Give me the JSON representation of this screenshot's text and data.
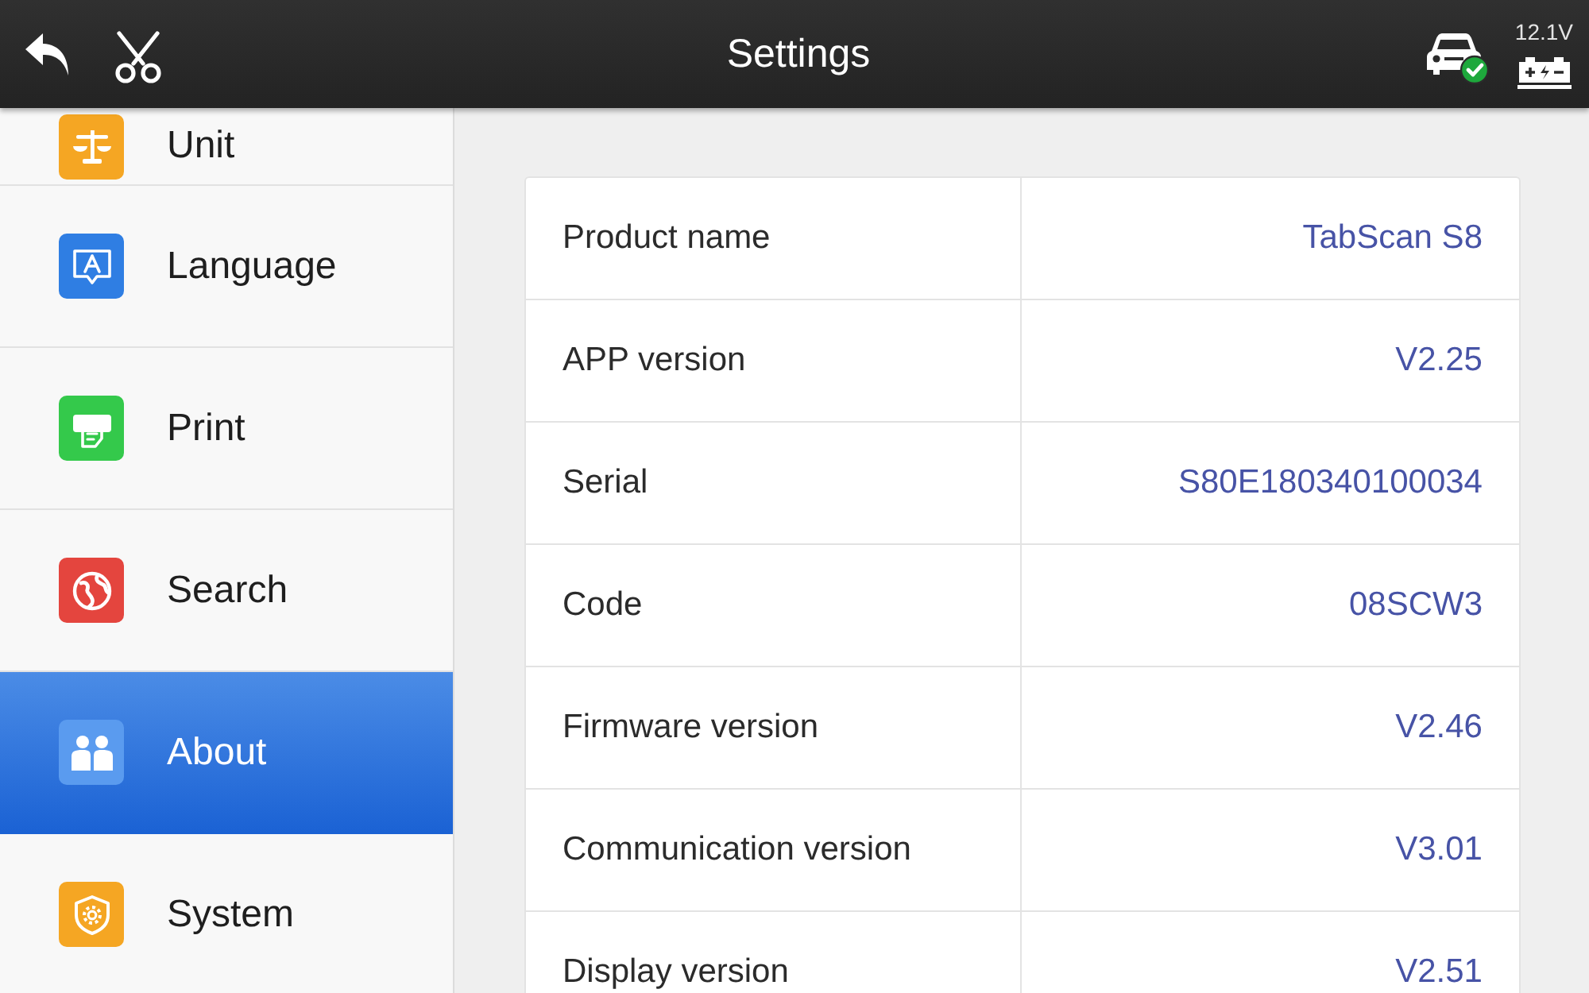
{
  "header": {
    "title": "Settings",
    "voltage": "12.1V"
  },
  "sidebar": {
    "items": [
      {
        "label": "Unit",
        "color": "#f5a623",
        "selected": false
      },
      {
        "label": "Language",
        "color": "#2f7ee3",
        "selected": false
      },
      {
        "label": "Print",
        "color": "#34c94b",
        "selected": false
      },
      {
        "label": "Search",
        "color": "#e4453e",
        "selected": false
      },
      {
        "label": "About",
        "color": "#5a9bef",
        "selected": true
      },
      {
        "label": "System",
        "color": "#f5a623",
        "selected": false
      }
    ]
  },
  "info_table": {
    "rows": [
      {
        "label": "Product name",
        "value": "TabScan S8"
      },
      {
        "label": "APP version",
        "value": "V2.25"
      },
      {
        "label": "Serial",
        "value": "S80E180340100034"
      },
      {
        "label": "Code",
        "value": "08SCW3"
      },
      {
        "label": "Firmware version",
        "value": "V2.46"
      },
      {
        "label": "Communication version",
        "value": "V3.01"
      },
      {
        "label": "Display version",
        "value": "V2.51"
      }
    ]
  }
}
